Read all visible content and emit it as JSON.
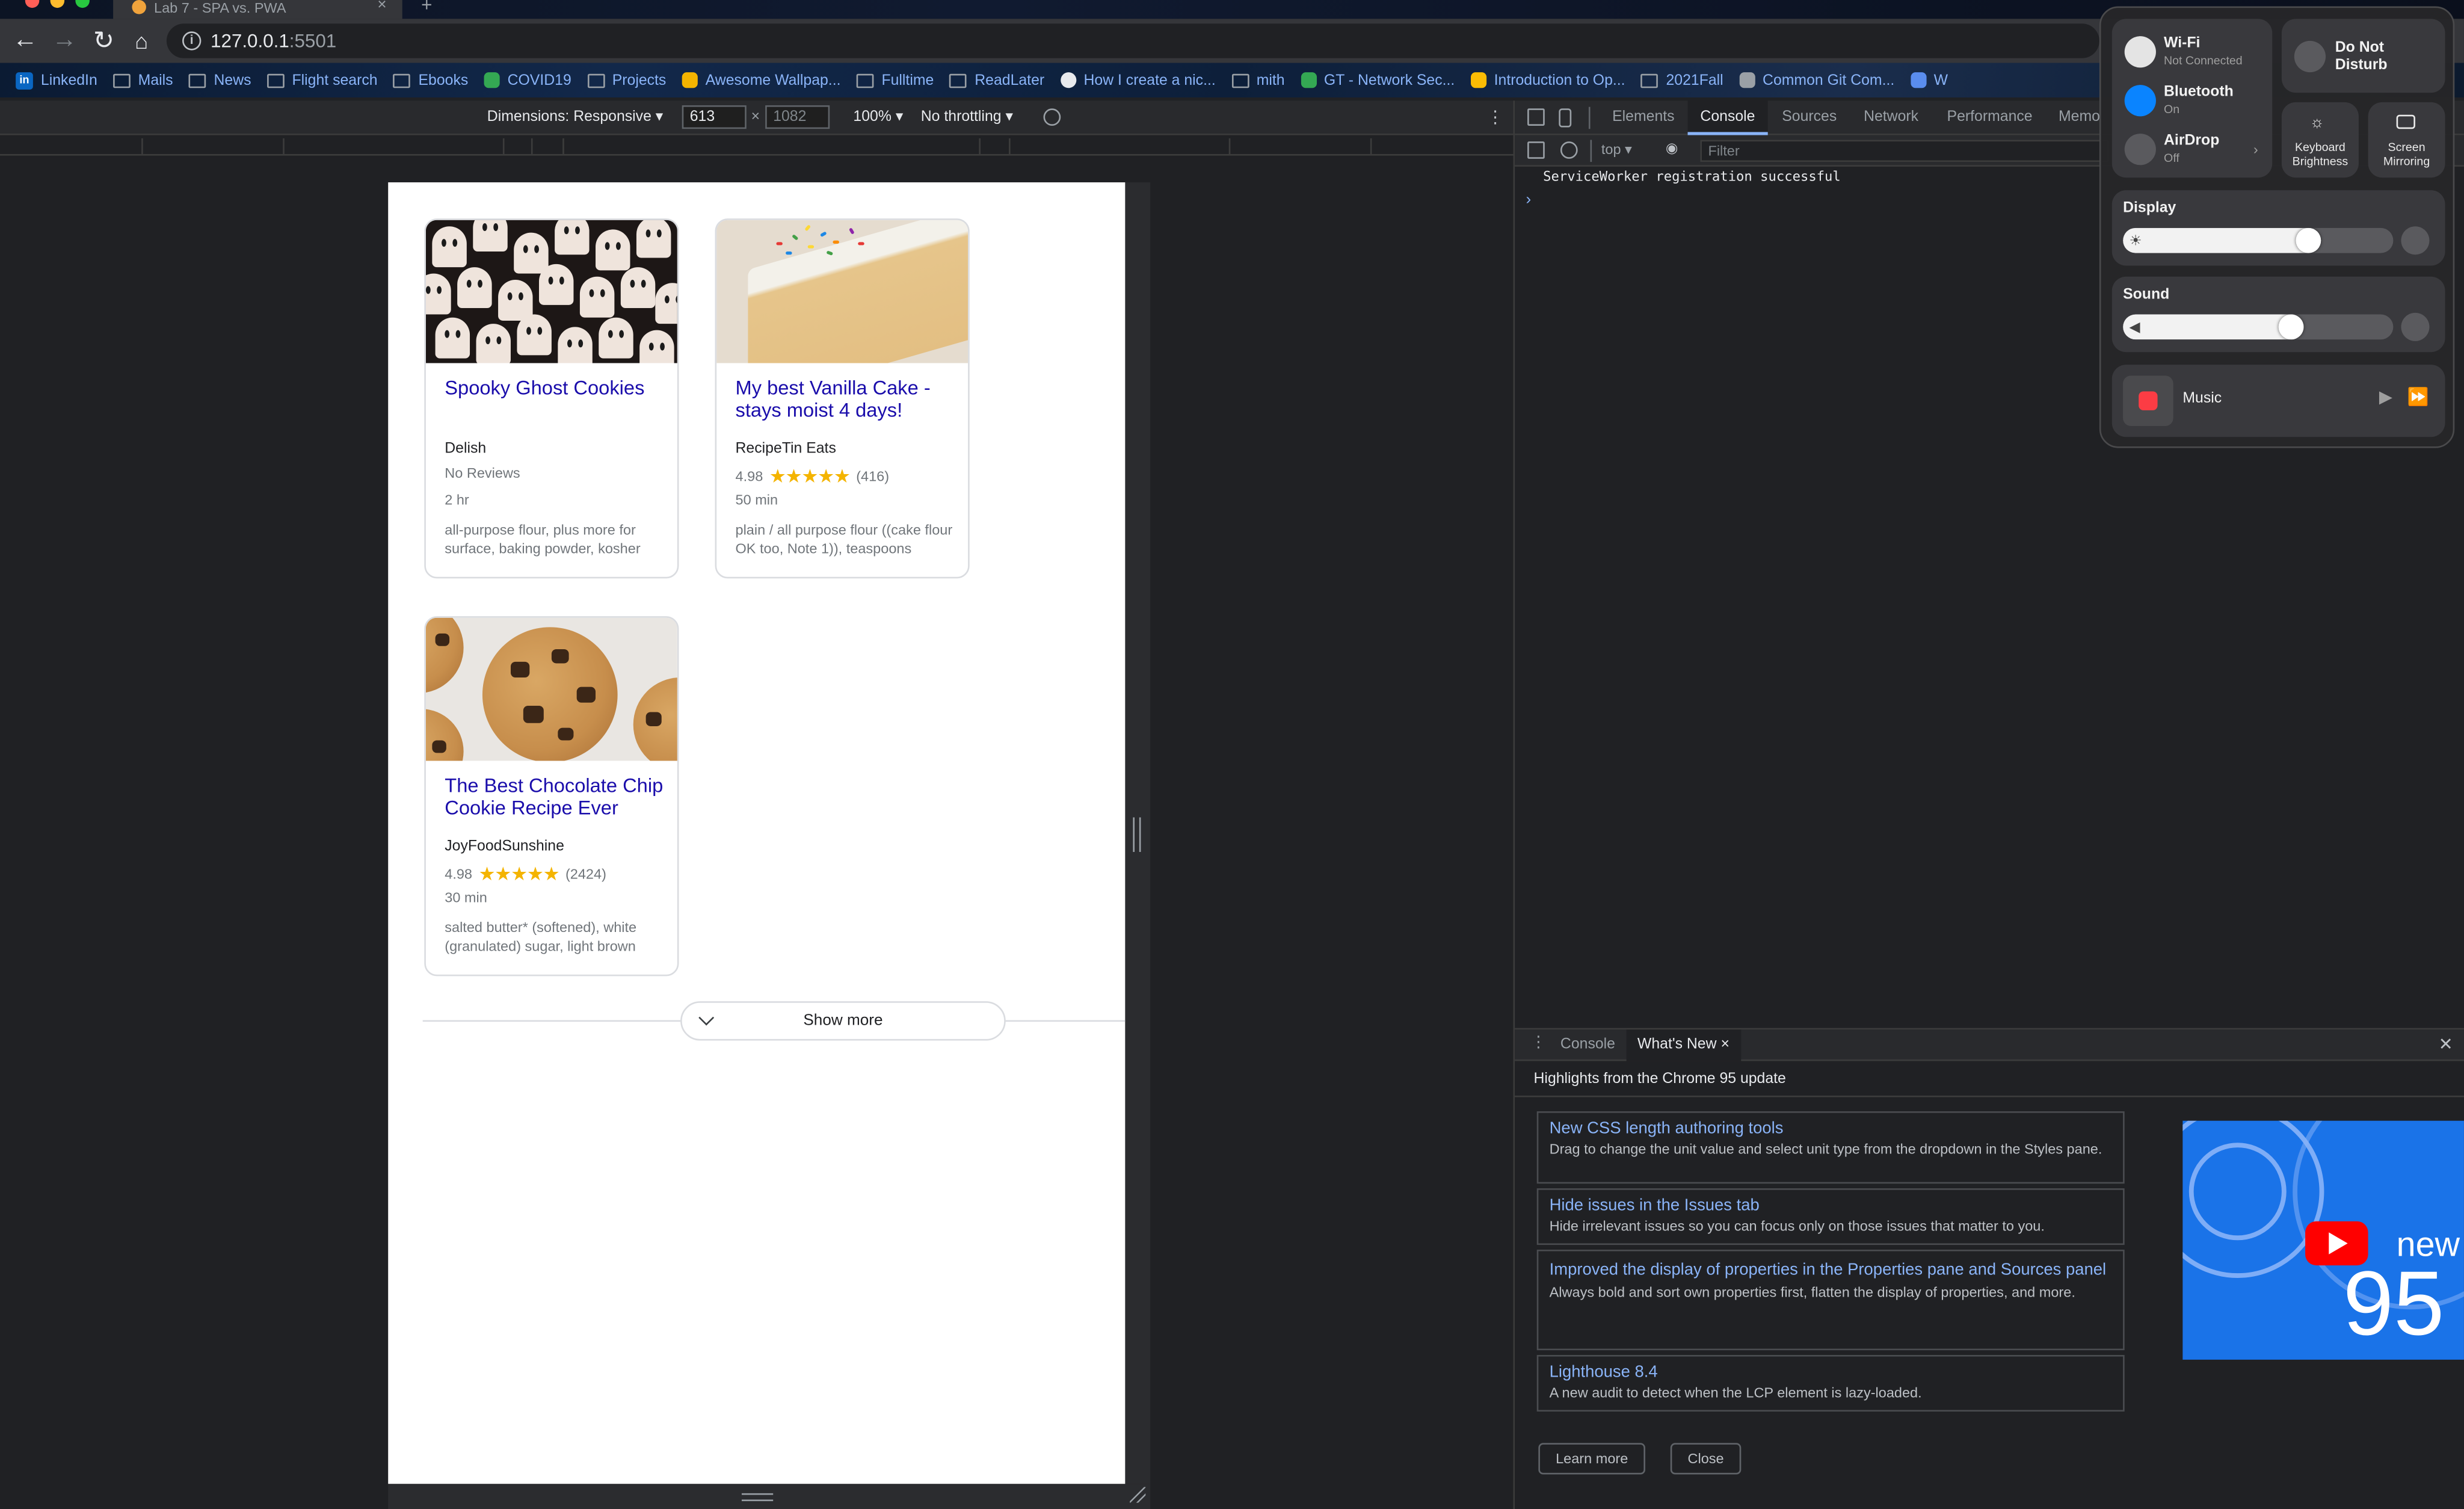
{
  "browser": {
    "tab_title": "Lab 7 - SPA vs. PWA",
    "url_host": "127.0.0.1",
    "url_port": ":5501",
    "bookmarks": [
      {
        "label": "LinkedIn",
        "icon": "linkedin-icon"
      },
      {
        "label": "Mails",
        "icon": "folder-icon"
      },
      {
        "label": "News",
        "icon": "folder-icon"
      },
      {
        "label": "Flight search",
        "icon": "folder-icon"
      },
      {
        "label": "Ebooks",
        "icon": "folder-icon"
      },
      {
        "label": "COVID19",
        "icon": "site-icon"
      },
      {
        "label": "Projects",
        "icon": "folder-icon"
      },
      {
        "label": "Awesome Wallpap...",
        "icon": "site-icon"
      },
      {
        "label": "Fulltime",
        "icon": "folder-icon"
      },
      {
        "label": "ReadLater",
        "icon": "folder-icon"
      },
      {
        "label": "How I create a nic...",
        "icon": "globe-icon"
      },
      {
        "label": "mith",
        "icon": "folder-icon"
      },
      {
        "label": "GT - Network Sec...",
        "icon": "site-icon"
      },
      {
        "label": "Introduction to Op...",
        "icon": "site-icon"
      },
      {
        "label": "2021Fall",
        "icon": "folder-icon"
      },
      {
        "label": "Common Git Com...",
        "icon": "site-icon"
      },
      {
        "label": "W",
        "icon": "site-icon"
      }
    ]
  },
  "device_toolbar": {
    "dimensions_label": "Dimensions: Responsive",
    "width": "613",
    "times": "×",
    "height": "1082",
    "zoom": "100%",
    "throttling": "No throttling"
  },
  "recipes": [
    {
      "title": "Spooky Ghost Cookies",
      "source": "Delish",
      "rating_text": "No Reviews",
      "rating_value": "",
      "stars": "",
      "review_count": "",
      "time": "2 hr",
      "ingredients": "all-purpose flour, plus more for surface, baking powder, kosher"
    },
    {
      "title": "My best Vanilla Cake - stays moist 4 days!",
      "source": "RecipeTin Eats",
      "rating_text": "",
      "rating_value": "4.98",
      "stars": "★★★★★",
      "review_count": "(416)",
      "time": "50 min",
      "ingredients": "plain / all purpose flour ((cake flour OK too, Note 1)), teaspoons"
    },
    {
      "title": "The Best Chocolate Chip Cookie Recipe Ever",
      "source": "JoyFoodSunshine",
      "rating_text": "",
      "rating_value": "4.98",
      "stars": "★★★★★",
      "review_count": "(2424)",
      "time": "30 min",
      "ingredients": "salted butter* (softened), white (granulated) sugar, light brown"
    }
  ],
  "show_more": "Show more",
  "devtools": {
    "tabs": [
      "Elements",
      "Console",
      "Sources",
      "Network",
      "Performance",
      "Memo"
    ],
    "active_tab": "Console",
    "context": "top",
    "filter_placeholder": "Filter",
    "log_message": "ServiceWorker registration successful",
    "prompt": "›",
    "drawer": {
      "tabs": [
        "Console",
        "What's New"
      ],
      "active_tab": "What's New",
      "close_tab": "×",
      "close_drawer": "✕",
      "heading": "Highlights from the Chrome 95 update",
      "items": [
        {
          "title": "New CSS length authoring tools",
          "desc": "Drag to change the unit value and select unit type from the dropdown in the Styles pane."
        },
        {
          "title": "Hide issues in the Issues tab",
          "desc": "Hide irrelevant issues so you can focus only on those issues that matter to you."
        },
        {
          "title": "Improved the display of properties in the Properties pane and Sources panel",
          "desc": "Always bold and sort own properties first, flatten the display of properties, and more."
        },
        {
          "title": "Lighthouse 8.4",
          "desc": "A new audit to detect when the LCP element is lazy-loaded."
        }
      ],
      "learn_more": "Learn more",
      "close": "Close",
      "video_text_new": "new",
      "video_text_95": "95"
    }
  },
  "control_center": {
    "wifi_label": "Wi-Fi",
    "wifi_status": "Not Connected",
    "bluetooth_label": "Bluetooth",
    "bluetooth_status": "On",
    "airdrop_label": "AirDrop",
    "airdrop_status": "Off",
    "dnd_label": "Do Not Disturb",
    "keyboard_label": "Keyboard Brightness",
    "mirroring_label": "Screen Mirroring",
    "display_label": "Display",
    "display_level": 0.73,
    "sound_label": "Sound",
    "sound_level": 0.67,
    "music_label": "Music",
    "accent": "#0a84ff"
  }
}
